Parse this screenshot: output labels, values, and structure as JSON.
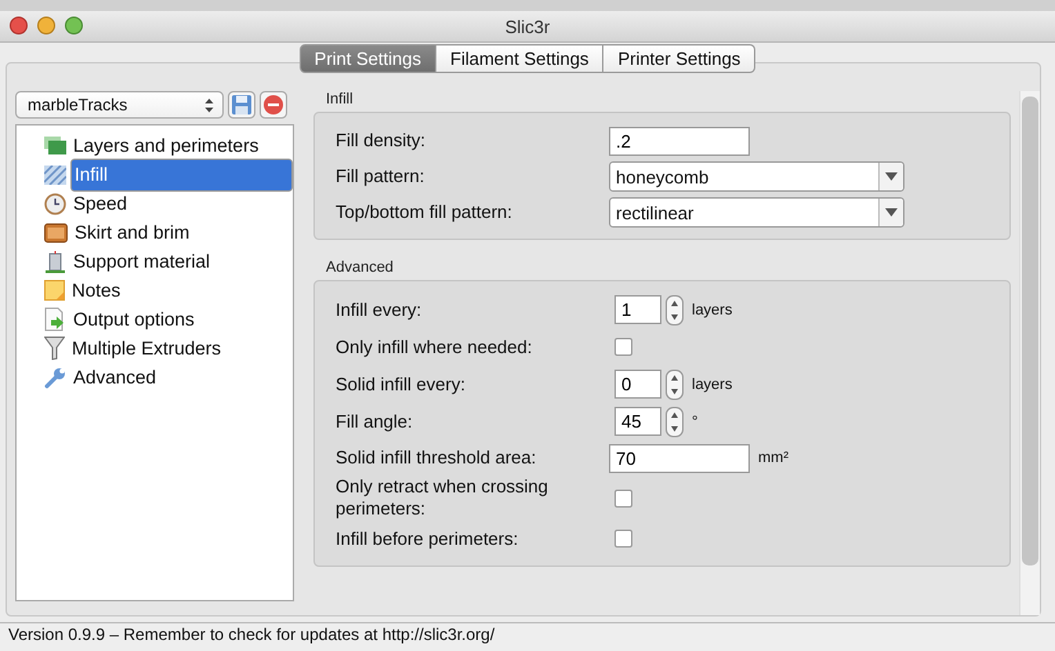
{
  "window": {
    "title": "Slic3r"
  },
  "tabs": [
    {
      "label": "Print Settings",
      "selected": true
    },
    {
      "label": "Filament Settings",
      "selected": false
    },
    {
      "label": "Printer Settings",
      "selected": false
    }
  ],
  "preset": {
    "value": "marbleTracks"
  },
  "sidebar": {
    "items": [
      {
        "label": "Layers and perimeters",
        "selected": false
      },
      {
        "label": "Infill",
        "selected": true
      },
      {
        "label": "Speed",
        "selected": false
      },
      {
        "label": "Skirt and brim",
        "selected": false
      },
      {
        "label": "Support material",
        "selected": false
      },
      {
        "label": "Notes",
        "selected": false
      },
      {
        "label": "Output options",
        "selected": false
      },
      {
        "label": "Multiple Extruders",
        "selected": false
      },
      {
        "label": "Advanced",
        "selected": false
      }
    ]
  },
  "groups": [
    {
      "title": "Infill",
      "fields": [
        {
          "kind": "text",
          "label": "Fill density:",
          "value": ".2"
        },
        {
          "kind": "select",
          "label": "Fill pattern:",
          "value": "honeycomb"
        },
        {
          "kind": "select",
          "label": "Top/bottom fill pattern:",
          "value": "rectilinear"
        }
      ]
    },
    {
      "title": "Advanced",
      "fields": [
        {
          "kind": "spin",
          "label": "Infill every:",
          "value": "1",
          "unit": "layers"
        },
        {
          "kind": "checkbox",
          "label": "Only infill where needed:",
          "checked": false
        },
        {
          "kind": "spin",
          "label": "Solid infill every:",
          "value": "0",
          "unit": "layers"
        },
        {
          "kind": "spin",
          "label": "Fill angle:",
          "value": "45",
          "unit": "°"
        },
        {
          "kind": "text",
          "label": "Solid infill threshold area:",
          "value": "70",
          "unit": "mm²"
        },
        {
          "kind": "checkbox",
          "label": "Only retract when crossing perimeters:",
          "checked": false
        },
        {
          "kind": "checkbox",
          "label": "Infill before perimeters:",
          "checked": false
        }
      ]
    }
  ],
  "status_bar": {
    "text": "Version 0.9.9 – Remember to check for updates at http://slic3r.org/"
  }
}
